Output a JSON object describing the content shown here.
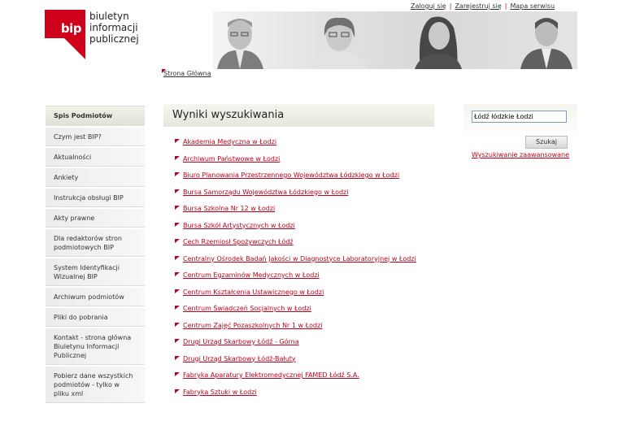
{
  "header": {
    "links": [
      {
        "label": "Zaloguj się"
      },
      {
        "label": "Zarejestruj się"
      },
      {
        "label": "Mapa serwisu"
      }
    ],
    "logo": {
      "mark": "bip",
      "line1": "biuletyn",
      "line2": "informacji publicznej"
    }
  },
  "breadcrumb": {
    "label": "Strona Główna"
  },
  "sidebar": {
    "title": "Spis Podmiotów",
    "items": [
      {
        "label": "Czym jest BIP?"
      },
      {
        "label": "Aktualności"
      },
      {
        "label": "Ankiety"
      },
      {
        "label": "Instrukcja obsługi BIP"
      },
      {
        "label": "Akty prawne"
      },
      {
        "label": "Dla redaktorów stron podmiotowych BIP"
      },
      {
        "label": "System Identyfikacji Wizualnej BIP"
      },
      {
        "label": "Archiwum podmiotów"
      },
      {
        "label": "Pliki do pobrania"
      },
      {
        "label": "Kontakt - strona główna Biuletynu Informacji Publicznej"
      },
      {
        "label": "Pobierz dane wszystkich podmiotów - tylko w pliku xml"
      }
    ]
  },
  "main": {
    "title": "Wyniki wyszukiwania",
    "results": [
      {
        "label": "Akademia Medyczna w Łodzi"
      },
      {
        "label": "Archiwum Państwowe w Łodzi"
      },
      {
        "label": "Biuro Planowania Przestrzennego Województwa Łódzkiego w Łodzi"
      },
      {
        "label": "Bursa Samorządu Województwa Łódzkiego w Łodzi"
      },
      {
        "label": "Bursa Szkolna Nr 12 w Łodzi"
      },
      {
        "label": "Bursa Szkół Artystycznych w Łodzi"
      },
      {
        "label": "Cech Rzemiosł Spożywczych Łódź"
      },
      {
        "label": "Centralny Ośrodek Badań Jakości w Diagnostyce Laboratoryjnej w Łodzi"
      },
      {
        "label": "Centrum Egzaminów Medycznych w Łodzi"
      },
      {
        "label": "Centrum Kształcenia Ustawicznego w Łodzi"
      },
      {
        "label": "Centrum Świadczeń Socjalnych w Łodzi"
      },
      {
        "label": "Centrum Zajęć Pozaszkolnych Nr 1 w Łodzi"
      },
      {
        "label": "Drugi Urząd Skarbowy Łódź - Górna"
      },
      {
        "label": "Drugi Urząd Skarbowy Łódź-Bałuty"
      },
      {
        "label": "Fabryka Aparatury Elektromedycznej FAMED Łódź S.A."
      },
      {
        "label": "Fabryka Sztuki w Łodzi"
      }
    ]
  },
  "search": {
    "value": "Łódź łódzkie Łodzi",
    "button_label": "Szukaj",
    "advanced_label": "Wyszukiwanie zaawansowane"
  },
  "colors": {
    "accent": "#c0001a",
    "logo": "#d0021b"
  }
}
